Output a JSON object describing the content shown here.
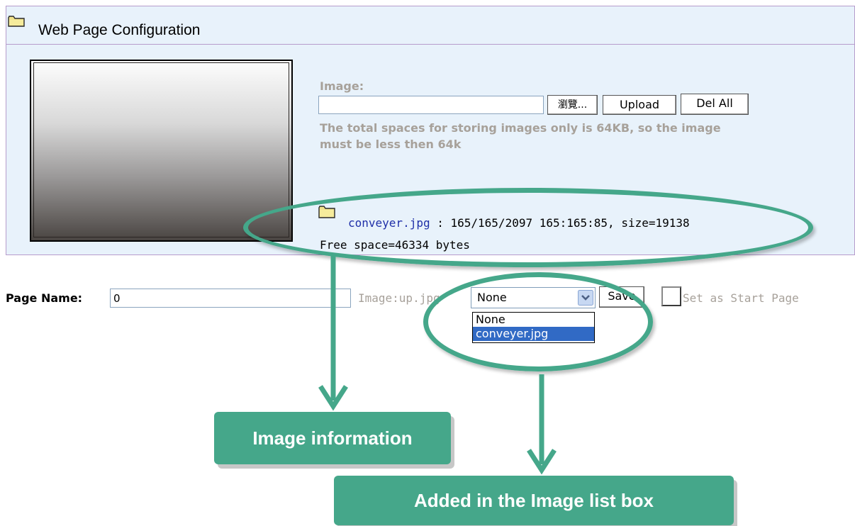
{
  "panel": {
    "title": "Web Page Configuration"
  },
  "upload": {
    "image_label": "Image:",
    "file_value": "",
    "browse_label": "瀏覽...",
    "upload_label": "Upload",
    "del_all_label": "Del All",
    "note_line1": "The total spaces for storing images only is 64KB, so the image",
    "note_line2": "must be less then 64k"
  },
  "image_info": {
    "filename": "conveyer.jpg",
    "details": ": 165/165/2097 165:165:85, size=19138",
    "free_space": "Free space=46334 bytes"
  },
  "page_form": {
    "page_name_label": "Page Name:",
    "page_name_value": "0",
    "image_label": "Image:up.jpg",
    "select_value": "None",
    "select_options": [
      "None",
      "conveyer.jpg"
    ],
    "highlighted_option": "conveyer.jpg",
    "save_label": "Save",
    "start_page_label": "Set as Start Page",
    "start_page_checked": false
  },
  "callouts": {
    "image_information": "Image information",
    "added_list_box": "Added in the Image list box"
  },
  "colors": {
    "accent_green": "#45a78a",
    "panel_bg": "#e8f2fb",
    "panel_border": "#b79ccc",
    "selected_option": "#316ac5"
  },
  "icons": [
    "folder-icon",
    "chevron-down-icon",
    "checkbox-icon",
    "arrow-down-icon"
  ]
}
